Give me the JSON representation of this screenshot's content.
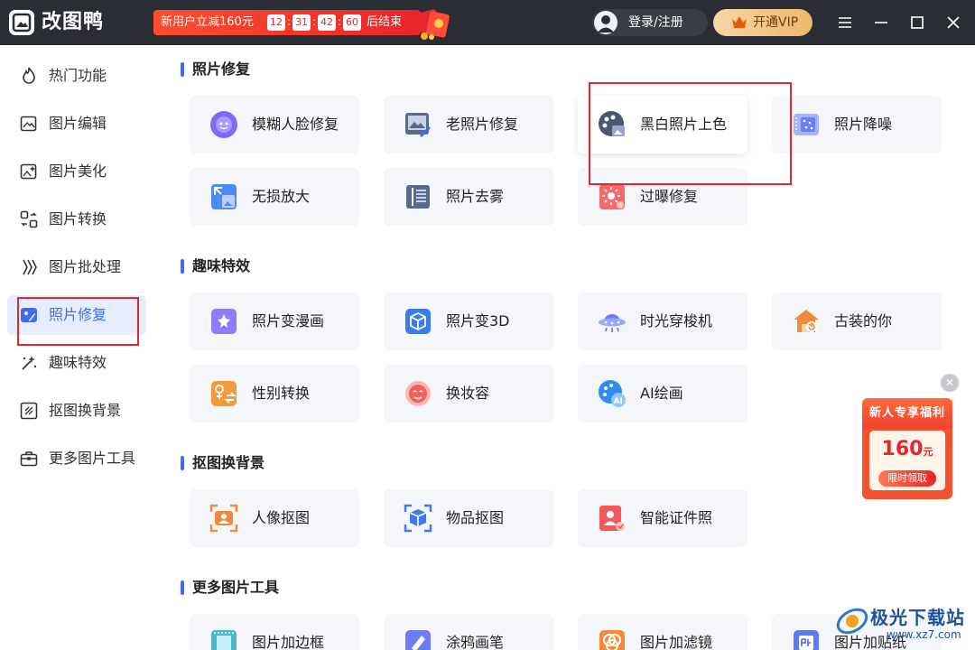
{
  "app": {
    "title": "改图鸭"
  },
  "promo": {
    "text": "新用户立减160元",
    "timer": [
      "12",
      "31",
      "42",
      "60"
    ],
    "suffix": "后结束"
  },
  "header": {
    "login_label": "登录/注册",
    "vip_label": "开通VIP"
  },
  "sidebar": {
    "items": [
      {
        "label": "热门功能",
        "icon": "fire-icon"
      },
      {
        "label": "图片编辑",
        "icon": "image-edit-icon"
      },
      {
        "label": "图片美化",
        "icon": "image-beautify-icon"
      },
      {
        "label": "图片转换",
        "icon": "convert-icon"
      },
      {
        "label": "图片批处理",
        "icon": "batch-icon"
      },
      {
        "label": "照片修复",
        "icon": "photo-repair-icon",
        "active": true
      },
      {
        "label": "趣味特效",
        "icon": "sparkle-icon"
      },
      {
        "label": "抠图换背景",
        "icon": "cutout-icon"
      },
      {
        "label": "更多图片工具",
        "icon": "toolbox-icon"
      }
    ]
  },
  "sections": [
    {
      "title": "照片修复",
      "items": [
        "模糊人脸修复",
        "老照片修复",
        "黑白照片上色",
        "照片降噪",
        "无损放大",
        "照片去雾",
        "过曝修复"
      ]
    },
    {
      "title": "趣味特效",
      "items": [
        "照片变漫画",
        "照片变3D",
        "时光穿梭机",
        "古装的你",
        "性别转换",
        "换妆容",
        "AI绘画"
      ]
    },
    {
      "title": "抠图换背景",
      "items": [
        "人像抠图",
        "物品抠图",
        "智能证件照"
      ]
    },
    {
      "title": "更多图片工具",
      "items": [
        "图片加边框",
        "涂鸦画笔",
        "图片加滤镜",
        "图片加贴纸"
      ]
    }
  ],
  "side_promo": {
    "title": "新人专享福利",
    "amount": "160",
    "unit": "元",
    "button": "限时领取"
  },
  "watermark": {
    "text": "极光下载站",
    "url": "www.xz7.com"
  },
  "colors": {
    "accent": "#3f6cf6",
    "titlebar": "#2a2d33",
    "highlight": "#e8252b"
  }
}
